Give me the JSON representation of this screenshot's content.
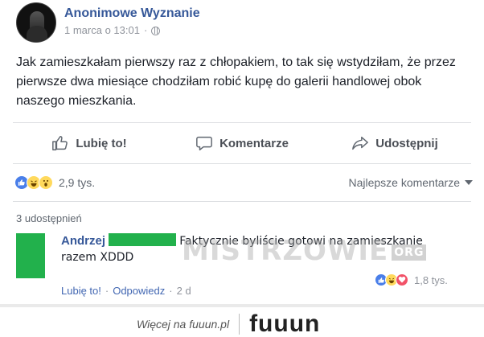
{
  "post": {
    "page_name": "Anonimowe Wyznanie",
    "date": "1 marca o 13:01",
    "meta_separator": "·",
    "text": "Jak zamieszkałam pierwszy raz z chłopakiem, to tak się wstydziłam, że przez pierwsze dwa miesiące chodziłam robić kupę do galerii handlowej obok naszego mieszkania."
  },
  "actions": {
    "like_label": "Lubię to!",
    "comment_label": "Komentarze",
    "share_label": "Udostępnij"
  },
  "reactions": {
    "count": "2,9 tys.",
    "sort_label": "Najlepsze komentarze"
  },
  "shares": {
    "label": "3 udostępnień"
  },
  "comment": {
    "author": "Andrzej",
    "text": "Faktycznie byliście gotowi na zamieszkanie razem XDDD",
    "reaction_count": "1,8 tys.",
    "like_link": "Lubię to!",
    "reply_link": "Odpowiedz",
    "separator": "·",
    "age": "2 d"
  },
  "watermark": {
    "text": "MISTRZOWIE",
    "badge": "ORG"
  },
  "footer": {
    "more_text": "Więcej na fuuun.pl",
    "brand": "fuuun"
  },
  "colors": {
    "link_blue": "#365899",
    "redaction_green": "#22b14c",
    "like_blue": "#4a7fe9"
  }
}
